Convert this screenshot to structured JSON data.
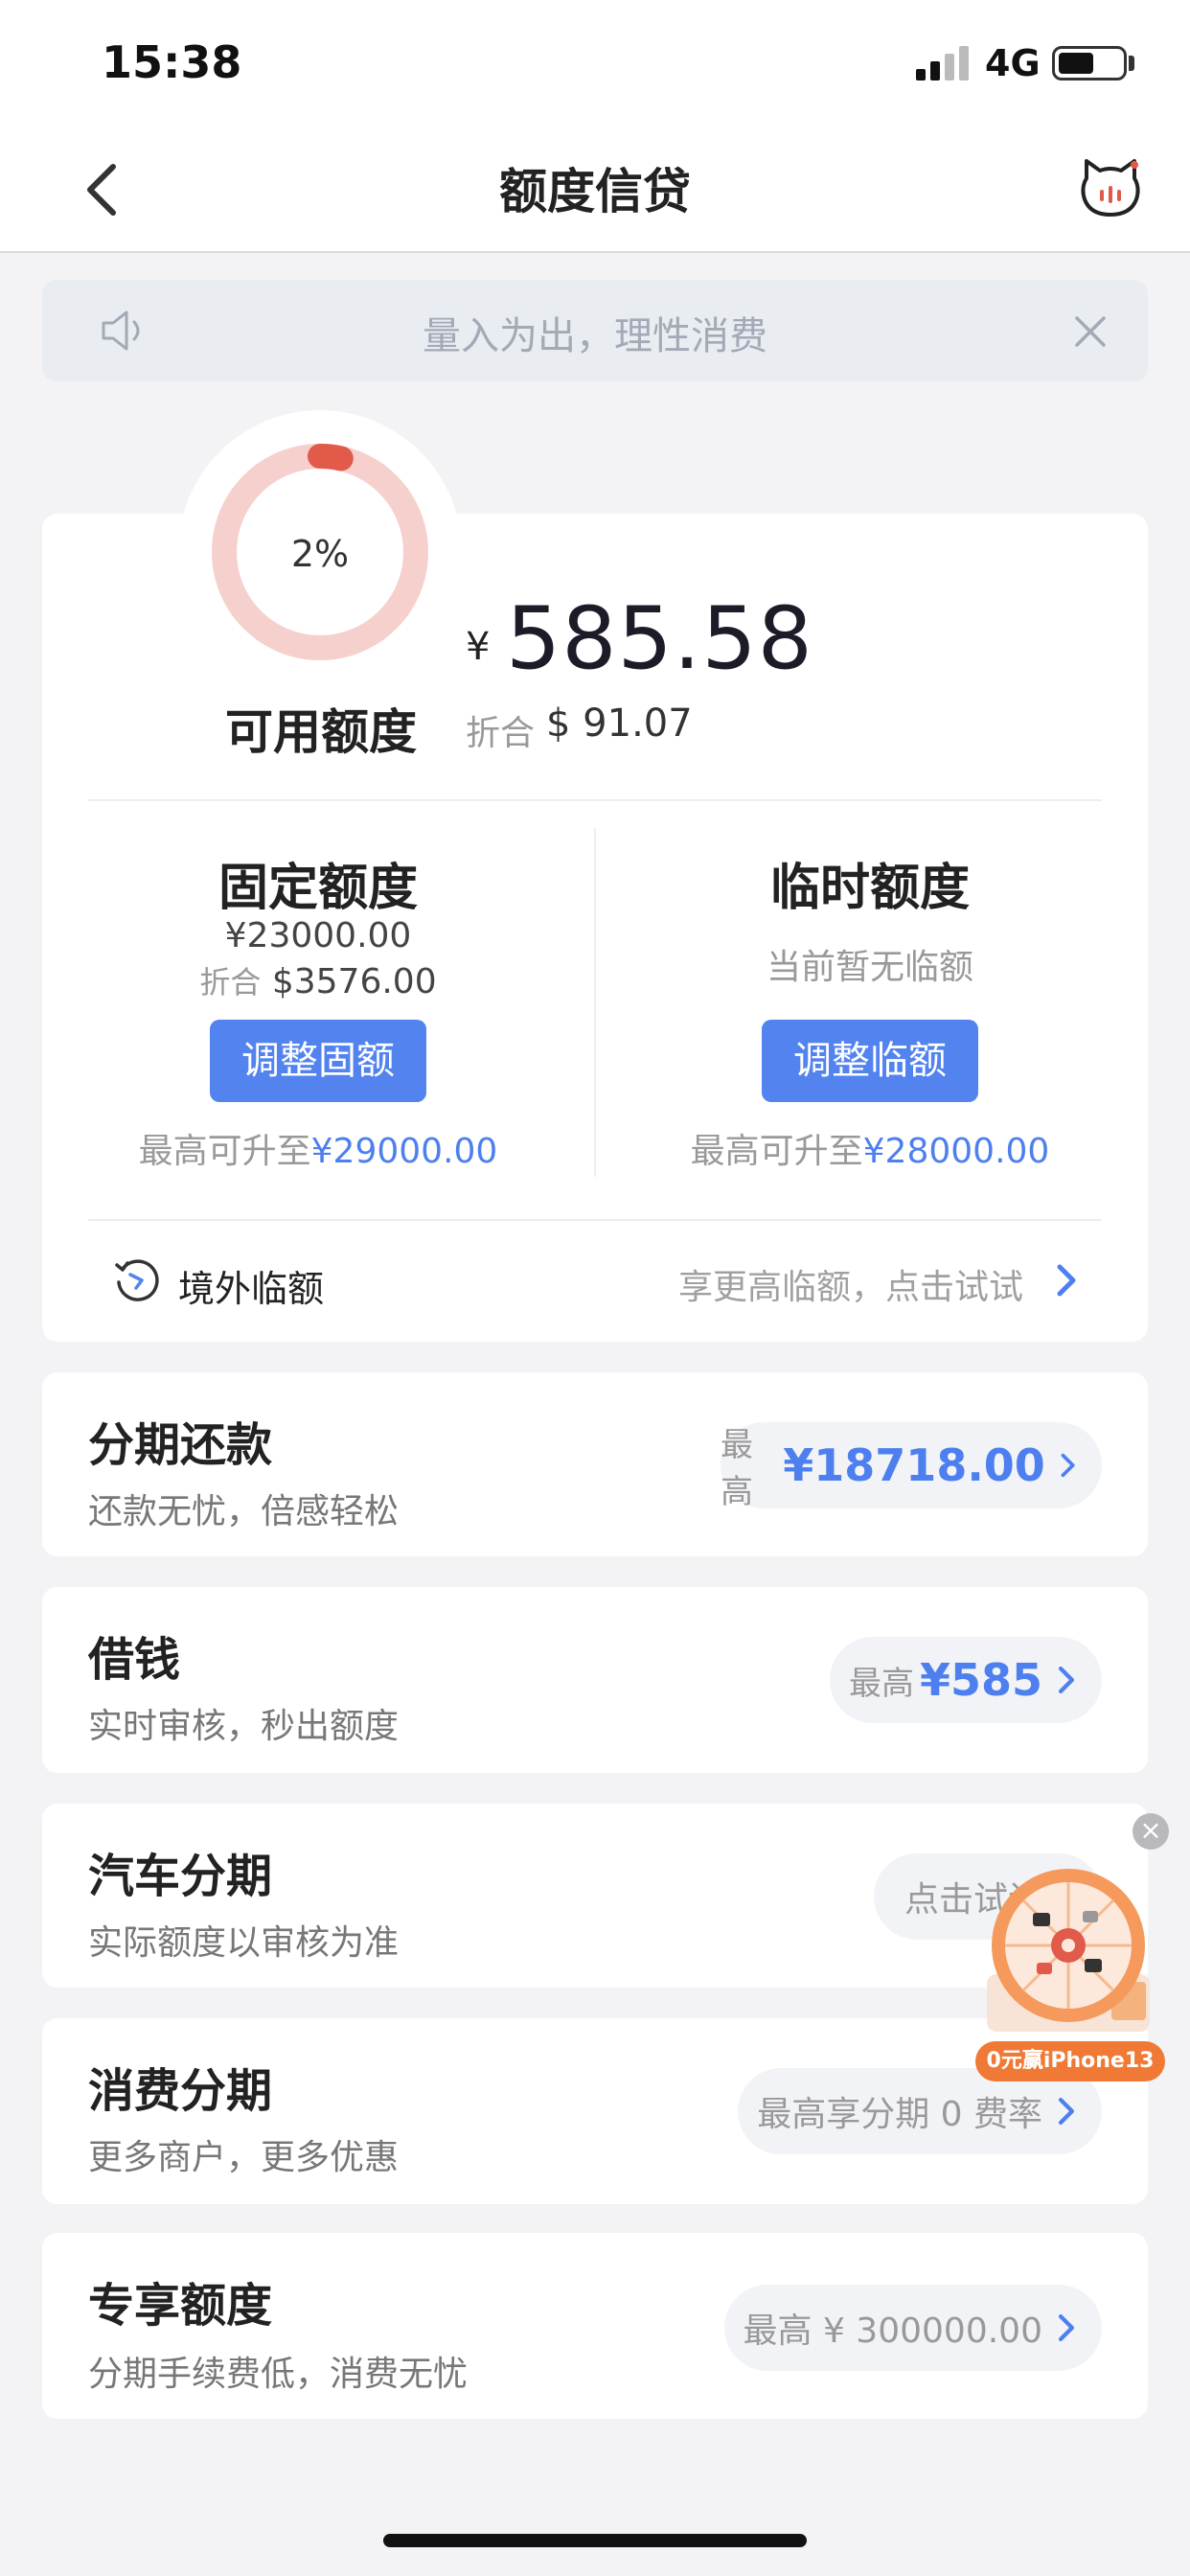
{
  "status_bar": {
    "time": "15:38",
    "network": "4G"
  },
  "nav": {
    "title": "额度信贷"
  },
  "notice": {
    "text": "量入为出，理性消费"
  },
  "credit": {
    "usage_percent_text": "2%",
    "usage_fraction": 0.02,
    "available_label": "可用额度",
    "currency_symbol": "¥",
    "available_amount": "585.58",
    "converted_label": "折合",
    "converted_value": "$ 91.07",
    "fixed": {
      "title": "固定额度",
      "amount": "¥23000.00",
      "converted_label": "折合",
      "converted_value": "$3576.00",
      "button": "调整固额",
      "max_prefix": "最高可升至",
      "max_value": "¥29000.00"
    },
    "temporary": {
      "title": "临时额度",
      "status": "当前暂无临额",
      "button": "调整临额",
      "max_prefix": "最高可升至",
      "max_value": "¥28000.00"
    },
    "overseas": {
      "label": "境外临额",
      "hint": "享更高临额，点击试试"
    }
  },
  "products": [
    {
      "title": "分期还款",
      "subtitle": "还款无忧，倍感轻松",
      "pill_prefix": "最高",
      "pill_value": "¥18718.00"
    },
    {
      "title": "借钱",
      "subtitle": "实时审核，秒出额度",
      "pill_prefix": "最高",
      "pill_value": "¥585"
    },
    {
      "title": "汽车分期",
      "subtitle": "实际额度以审核为准",
      "pill_text": "点击试试"
    },
    {
      "title": "消费分期",
      "subtitle": "更多商户，更多优惠",
      "pill_text": "最高享分期 0 费率"
    },
    {
      "title": "专享额度",
      "subtitle": "分期手续费低，消费无忧",
      "pill_text": "最高 ¥ 300000.00"
    }
  ],
  "promo": {
    "label": "0元赢iPhone13"
  },
  "colors": {
    "accent_blue": "#5283ef",
    "ring_red": "#e15a4a",
    "ring_track": "#f6d0cc"
  }
}
